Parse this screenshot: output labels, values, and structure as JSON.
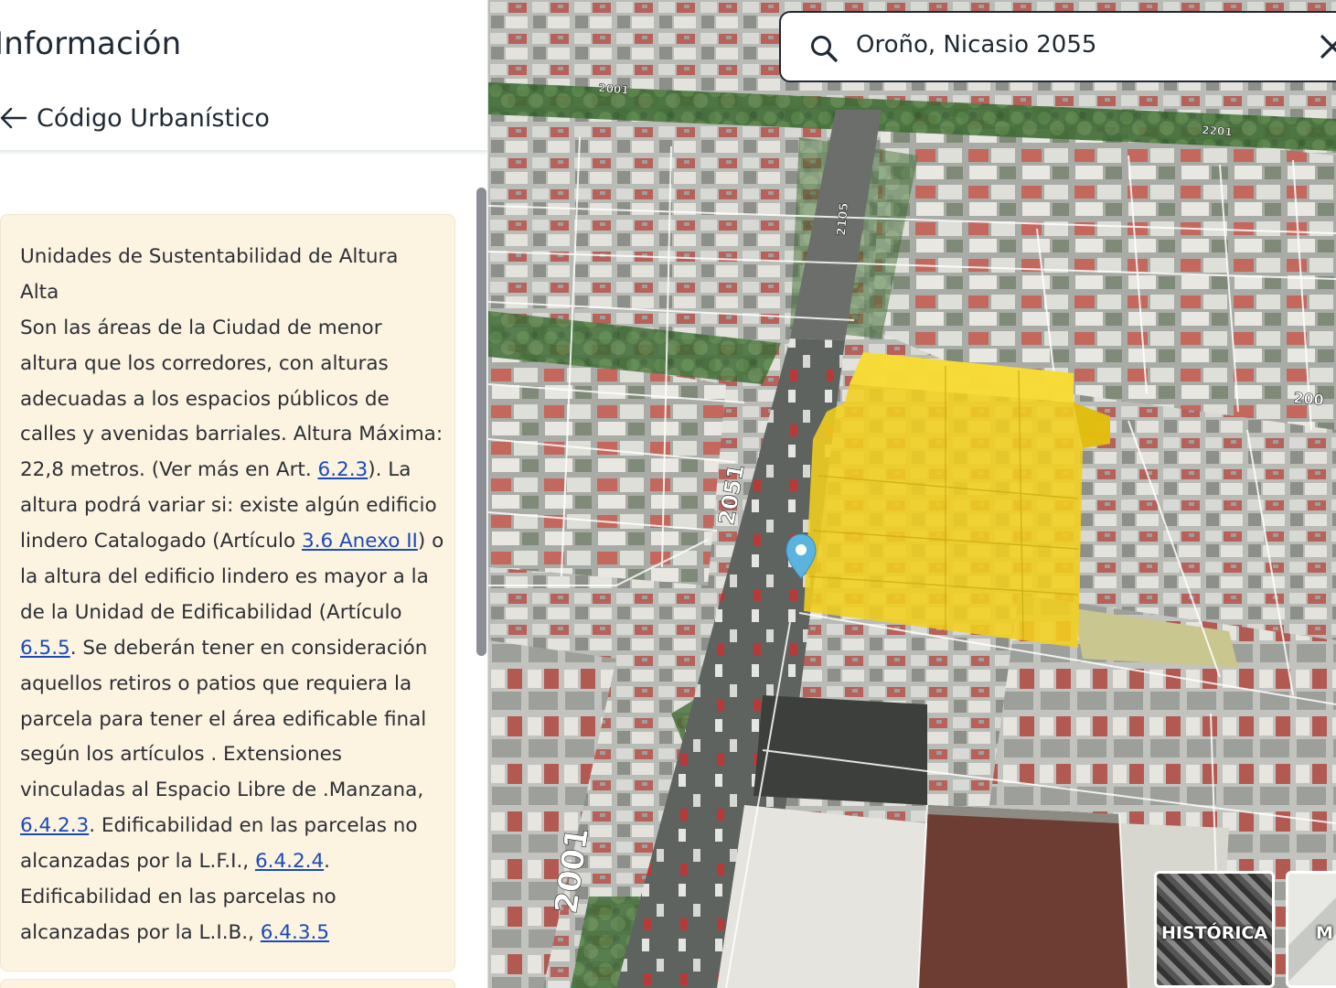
{
  "panel": {
    "title": "Información",
    "back_label": "Código Urbanístico"
  },
  "info": {
    "lines": [
      [
        {
          "t": "Unidades de Sustentabilidad de Altura"
        }
      ],
      [
        {
          "t": "Alta"
        }
      ],
      [
        {
          "t": "Son las áreas de la Ciudad de menor"
        }
      ],
      [
        {
          "t": "altura que los corredores, con alturas"
        }
      ],
      [
        {
          "t": "adecuadas a los espacios públicos de"
        }
      ],
      [
        {
          "t": "calles y avenidas barriales. Altura Máxima:"
        }
      ],
      [
        {
          "t": "22,8 metros. (Ver más en Art. "
        },
        {
          "t": "6.2.3",
          "link": true
        },
        {
          "t": "). La"
        }
      ],
      [
        {
          "t": "altura podrá variar si: existe algún edificio"
        }
      ],
      [
        {
          "t": "lindero Catalogado (Artículo "
        },
        {
          "t": "3.6 Anexo II",
          "link": true
        },
        {
          "t": ") o"
        }
      ],
      [
        {
          "t": "la altura del edificio lindero es mayor a la"
        }
      ],
      [
        {
          "t": "de la Unidad de Edificabilidad (Artículo"
        }
      ],
      [
        {
          "t": "6.5.5",
          "link": true
        },
        {
          "t": ". Se deberán tener en consideración"
        }
      ],
      [
        {
          "t": "aquellos retiros o patios que requiera la"
        }
      ],
      [
        {
          "t": "parcela para tener el área edificable final"
        }
      ],
      [
        {
          "t": "según los artículos . Extensiones"
        }
      ],
      [
        {
          "t": "vinculadas al Espacio Libre de .Manzana,"
        }
      ],
      [
        {
          "t": "6.4.2.3",
          "link": true
        },
        {
          "t": ". Edificabilidad en las parcelas no"
        }
      ],
      [
        {
          "t": "alcanzadas por la L.F.I., "
        },
        {
          "t": "6.4.2.4",
          "link": true
        },
        {
          "t": "."
        }
      ],
      [
        {
          "t": "Edificabilidad en las parcelas no"
        }
      ],
      [
        {
          "t": "alcanzadas por la L.I.B., "
        },
        {
          "t": "6.4.3.5",
          "link": true
        }
      ]
    ]
  },
  "search": {
    "value": "Oroño, Nicasio 2055"
  },
  "map": {
    "street_numbers": [
      "2051",
      "2001",
      "2105",
      "2001",
      "2201",
      "200"
    ],
    "layers": [
      {
        "label": "HISTÓRICA"
      },
      {
        "label": "M"
      }
    ]
  },
  "colors": {
    "link": "#1a4bb8",
    "card_bg": "#fdf3e1",
    "building_volume": "#f2cf1e",
    "marker": "#5ab4de"
  },
  "icons": [
    "arrow-left-icon",
    "search-icon",
    "close-icon",
    "location-pin-icon"
  ]
}
